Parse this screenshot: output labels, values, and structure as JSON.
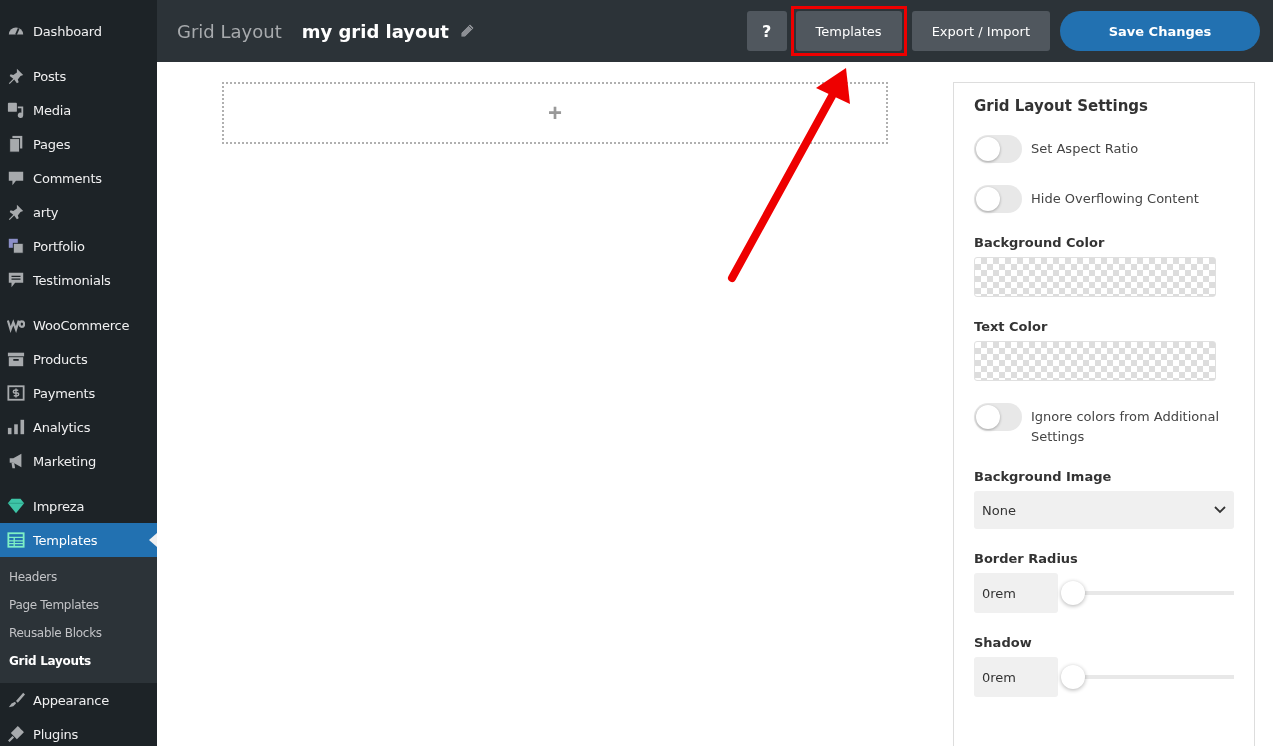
{
  "sidebar": {
    "groups": [
      [
        {
          "label": "Dashboard",
          "selected": false
        }
      ],
      [
        {
          "label": "Posts",
          "selected": false
        },
        {
          "label": "Media",
          "selected": false
        },
        {
          "label": "Pages",
          "selected": false
        },
        {
          "label": "Comments",
          "selected": false
        },
        {
          "label": "arty",
          "selected": false
        },
        {
          "label": "Portfolio",
          "selected": false
        },
        {
          "label": "Testimonials",
          "selected": false
        }
      ],
      [
        {
          "label": "WooCommerce",
          "selected": false
        },
        {
          "label": "Products",
          "selected": false
        },
        {
          "label": "Payments",
          "selected": false
        },
        {
          "label": "Analytics",
          "selected": false
        },
        {
          "label": "Marketing",
          "selected": false
        }
      ],
      [
        {
          "label": "Impreza",
          "selected": false
        },
        {
          "label": "Templates",
          "selected": true,
          "children": [
            {
              "label": "Headers",
              "selected": false
            },
            {
              "label": "Page Templates",
              "selected": false
            },
            {
              "label": "Reusable Blocks",
              "selected": false
            },
            {
              "label": "Grid Layouts",
              "selected": true
            }
          ]
        },
        {
          "label": "Appearance",
          "selected": false
        },
        {
          "label": "Plugins",
          "selected": false
        }
      ]
    ]
  },
  "header": {
    "section": "Grid Layout",
    "title": "my grid layout",
    "help": "?",
    "buttons": [
      {
        "label": "Templates",
        "kind": "secondary",
        "highlighted": true
      },
      {
        "label": "Export / Import",
        "kind": "secondary",
        "highlighted": false
      },
      {
        "label": "Save Changes",
        "kind": "primary",
        "highlighted": false
      }
    ]
  },
  "canvas": {
    "add_row": "+"
  },
  "settings": {
    "title": "Grid Layout Settings",
    "items": [
      {
        "kind": "toggle",
        "label": "Set Aspect Ratio",
        "on": false
      },
      {
        "kind": "toggle",
        "label": "Hide Overflowing Content",
        "on": false
      },
      {
        "kind": "color",
        "label": "Background Color"
      },
      {
        "kind": "color",
        "label": "Text Color"
      },
      {
        "kind": "toggle",
        "label": "Ignore colors from Additional Settings",
        "on": false
      },
      {
        "kind": "select",
        "label": "Background Image",
        "value": "None"
      },
      {
        "kind": "slider",
        "label": "Border Radius",
        "value": "0rem",
        "level": 0
      },
      {
        "kind": "slider",
        "label": "Shadow",
        "value": "0rem",
        "level": 0
      }
    ]
  }
}
